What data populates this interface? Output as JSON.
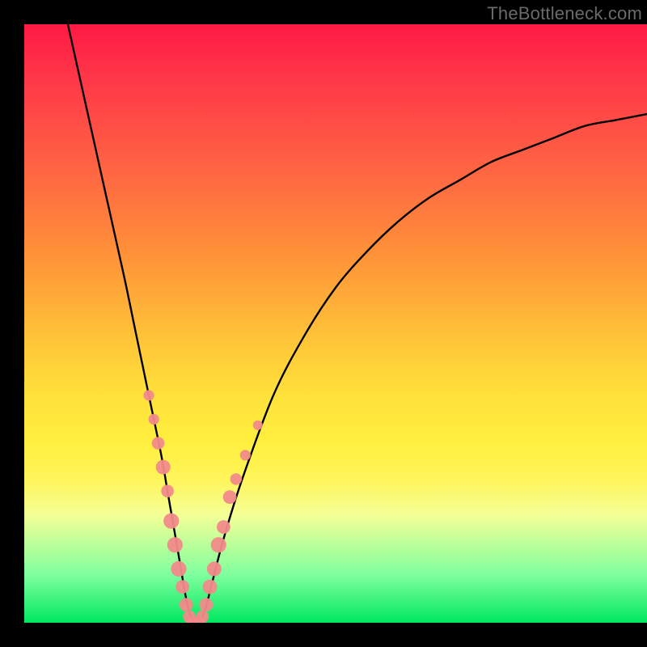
{
  "watermark": "TheBottleneck.com",
  "chart_data": {
    "type": "line",
    "title": "",
    "xlabel": "",
    "ylabel": "",
    "xlim": [
      0,
      100
    ],
    "ylim": [
      0,
      100
    ],
    "grid": false,
    "legend": false,
    "series": [
      {
        "name": "bottleneck-curve",
        "x": [
          7,
          10,
          13,
          16,
          18,
          20,
          22,
          23,
          24,
          25,
          26,
          27,
          28,
          29,
          30,
          32,
          35,
          40,
          45,
          50,
          55,
          60,
          65,
          70,
          75,
          80,
          85,
          90,
          95,
          100
        ],
        "y": [
          100,
          86,
          72,
          58,
          48,
          38,
          28,
          22,
          16,
          10,
          4,
          0,
          0,
          2,
          6,
          14,
          24,
          38,
          48,
          56,
          62,
          67,
          71,
          74,
          77,
          79,
          81,
          83,
          84,
          85
        ]
      }
    ],
    "markers": {
      "name": "highlighted-points",
      "color": "#f28a8a",
      "points": [
        {
          "x": 20.0,
          "y": 38,
          "r": 1.1
        },
        {
          "x": 20.8,
          "y": 34,
          "r": 1.1
        },
        {
          "x": 21.5,
          "y": 30,
          "r": 1.3
        },
        {
          "x": 22.3,
          "y": 26,
          "r": 1.5
        },
        {
          "x": 23.0,
          "y": 22,
          "r": 1.3
        },
        {
          "x": 23.6,
          "y": 17,
          "r": 1.6
        },
        {
          "x": 24.2,
          "y": 13,
          "r": 1.6
        },
        {
          "x": 24.8,
          "y": 9,
          "r": 1.6
        },
        {
          "x": 25.4,
          "y": 6,
          "r": 1.4
        },
        {
          "x": 26.0,
          "y": 3,
          "r": 1.4
        },
        {
          "x": 26.5,
          "y": 1,
          "r": 1.3
        },
        {
          "x": 27.0,
          "y": 0,
          "r": 1.3
        },
        {
          "x": 27.5,
          "y": 0,
          "r": 1.3
        },
        {
          "x": 28.0,
          "y": 0,
          "r": 1.3
        },
        {
          "x": 28.6,
          "y": 1,
          "r": 1.3
        },
        {
          "x": 29.2,
          "y": 3,
          "r": 1.4
        },
        {
          "x": 29.8,
          "y": 6,
          "r": 1.5
        },
        {
          "x": 30.5,
          "y": 9,
          "r": 1.5
        },
        {
          "x": 31.2,
          "y": 13,
          "r": 1.6
        },
        {
          "x": 32.0,
          "y": 16,
          "r": 1.4
        },
        {
          "x": 33.0,
          "y": 21,
          "r": 1.4
        },
        {
          "x": 34.0,
          "y": 24,
          "r": 1.2
        },
        {
          "x": 35.5,
          "y": 28,
          "r": 1.1
        },
        {
          "x": 37.5,
          "y": 33,
          "r": 1.0
        }
      ]
    },
    "gradient_stops": [
      {
        "pos": 0,
        "color": "#ff1a46"
      },
      {
        "pos": 10,
        "color": "#ff3a48"
      },
      {
        "pos": 26,
        "color": "#ff6a42"
      },
      {
        "pos": 38,
        "color": "#ff9038"
      },
      {
        "pos": 52,
        "color": "#ffc238"
      },
      {
        "pos": 62,
        "color": "#ffe13a"
      },
      {
        "pos": 70,
        "color": "#ffef3f"
      },
      {
        "pos": 76,
        "color": "#fff55a"
      },
      {
        "pos": 82,
        "color": "#f4ff96"
      },
      {
        "pos": 92,
        "color": "#7fff9e"
      },
      {
        "pos": 100,
        "color": "#00e860"
      }
    ]
  }
}
